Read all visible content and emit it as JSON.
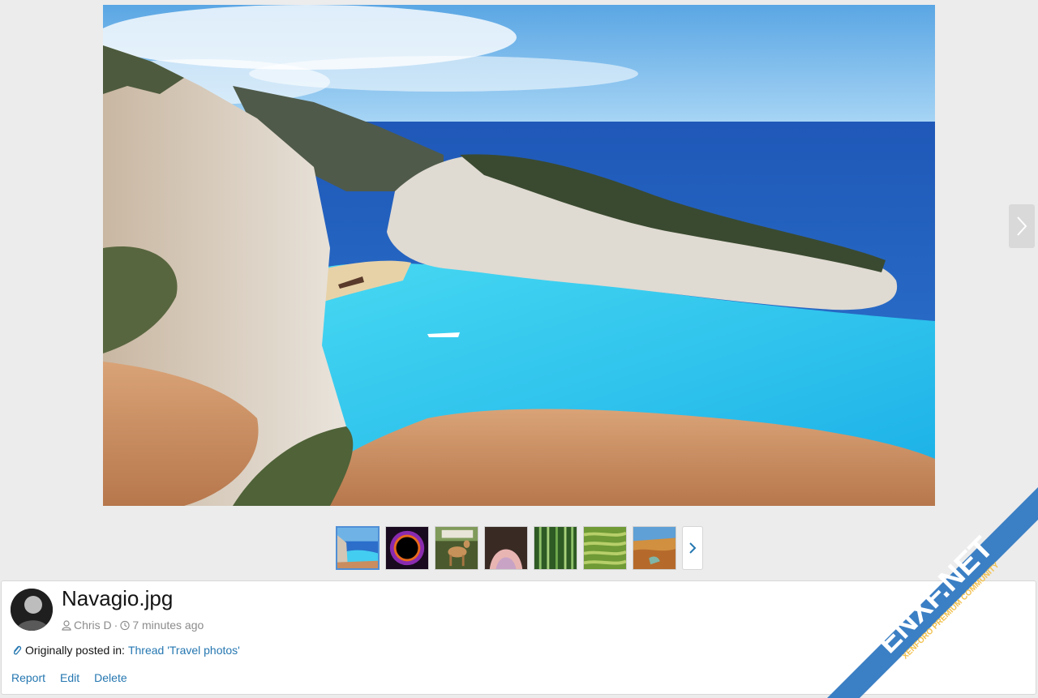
{
  "viewer": {
    "main_image_alt": "Navagio.jpg",
    "thumbnails": [
      {
        "name": "navagio-thumb",
        "active": true
      },
      {
        "name": "eclipse-thumb",
        "active": false
      },
      {
        "name": "deer-thumb",
        "active": false
      },
      {
        "name": "cave-thumb",
        "active": false
      },
      {
        "name": "bamboo-thumb",
        "active": false
      },
      {
        "name": "terraces-thumb",
        "active": false
      },
      {
        "name": "canyon-thumb",
        "active": false
      }
    ]
  },
  "media": {
    "title": "Navagio.jpg",
    "author": "Chris D",
    "separator": "·",
    "time": "7 minutes ago",
    "origin_label": "Originally posted in:",
    "origin_link": "Thread 'Travel photos'"
  },
  "actions": {
    "report": "Report",
    "edit": "Edit",
    "delete": "Delete"
  },
  "watermark": {
    "line1": "ENXF.NET",
    "line2": "XENFORO PREMIUM COMMUNITY"
  },
  "colors": {
    "link": "#2577b1",
    "watermark": "#3b7fc4",
    "background": "#ececec"
  }
}
